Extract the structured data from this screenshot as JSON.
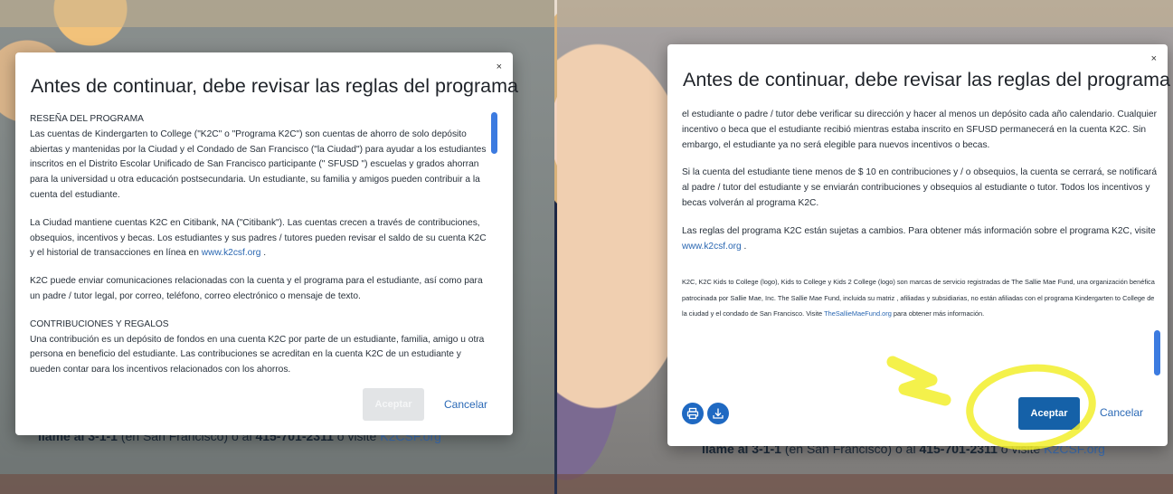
{
  "colors": {
    "accent": "#1561a8",
    "link": "#2a67b2",
    "highlight": "#f2ee2c",
    "disabled_button": "#e2e4e6"
  },
  "background": {
    "behind_text_prefix": "llame al 3-1-1",
    "behind_text_city": "(en San Francisco) o al",
    "behind_text_phone": "415-701-2311",
    "behind_text_suffix": "o visite",
    "behind_text_link": "K2CSF.org"
  },
  "left_modal": {
    "close": "×",
    "title": "Antes de continuar, debe revisar las reglas del programa",
    "paragraphs": [
      {
        "heading": "RESEÑA DEL PROGRAMA",
        "text": "Las cuentas de Kindergarten to College (\"K2C\" o \"Programa K2C\") son cuentas de ahorro de solo depósito abiertas y mantenidas por la Ciudad y el Condado de San Francisco (\"la Ciudad\") para ayudar a los estudiantes inscritos en el Distrito Escolar Unificado de San Francisco participante (\" SFUSD \") escuelas y grados ahorran para la universidad u otra educación postsecundaria. Un estudiante, su familia y amigos pueden contribuir a la cuenta del estudiante."
      },
      {
        "text": "La Ciudad mantiene cuentas K2C en Citibank, NA (\"Citibank\"). Las cuentas crecen a través de contribuciones, obsequios, incentivos y becas. Los estudiantes y sus padres / tutores pueden revisar el saldo de su cuenta K2C y el historial de transacciones en línea en",
        "link": "www.k2csf.org",
        "after": " ."
      },
      {
        "text": "K2C puede enviar comunicaciones relacionadas con la cuenta y el programa para el estudiante, así como para un padre / tutor legal, por correo, teléfono, correo electrónico o mensaje de texto."
      },
      {
        "heading": "CONTRIBUCIONES Y REGALOS",
        "text": "Una contribución es un depósito de fondos en una cuenta K2C por parte de un estudiante, familia, amigo u otra persona en beneficio del estudiante. Las contribuciones se acreditan en la cuenta K2C de un estudiante y pueden contar para los incentivos relacionados con los ahorros."
      }
    ],
    "accept_label": "Aceptar",
    "cancel_label": "Cancelar"
  },
  "right_modal": {
    "close": "×",
    "title": "Antes de continuar, debe revisar las reglas del programa",
    "p1": "el estudiante o padre / tutor debe verificar su dirección y hacer al menos un depósito cada año calendario. Cualquier incentivo o beca que el estudiante recibió mientras estaba inscrito en SFUSD permanecerá en la cuenta K2C. Sin embargo, el estudiante ya no será elegible para nuevos incentivos o becas.",
    "p2": "Si la cuenta del estudiante tiene menos de $ 10 en contribuciones y / o obsequios, la cuenta se cerrará, se notificará al padre / tutor del estudiante y se enviarán contribuciones y obsequios al estudiante o tutor. Todos los incentivos y becas volverán al programa K2C.",
    "p3": "Las reglas del programa K2C están sujetas a cambios. Para obtener más información sobre el programa K2C, visite",
    "p3_link": "www.k2csf.org",
    "p3_after": " .",
    "p4": "K2C, K2C Kids to College (logo), Kids to College y Kids 2 College (logo) son marcas de servicio registradas de The Sallie Mae Fund, una organización benéfica patrocinada por Sallie Mae, Inc. The Sallie Mae Fund, incluida su matriz , afiliadas y subsidiarias, no están afiliadas con el programa Kindergarten to College de la ciudad y el condado de San Francisco. Visite",
    "p4_link": "TheSallieMaeFund.org",
    "p4_after": " para obtener más información.",
    "print_icon": "printer-icon",
    "download_icon": "download-icon",
    "accept_label": "Aceptar",
    "cancel_label": "Cancelar"
  }
}
